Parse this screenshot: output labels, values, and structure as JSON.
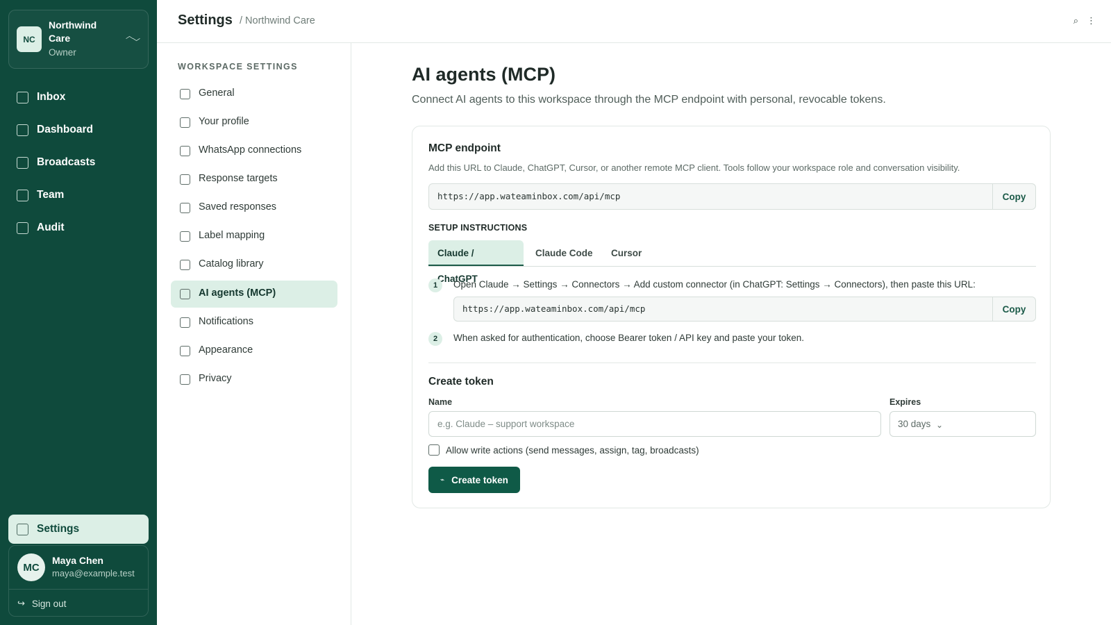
{
  "workspace": {
    "initials": "NC",
    "name": "Northwind Care",
    "role": "Owner"
  },
  "app_nav": [
    {
      "label": "Inbox"
    },
    {
      "label": "Dashboard"
    },
    {
      "label": "Broadcasts"
    },
    {
      "label": "Team"
    },
    {
      "label": "Audit"
    }
  ],
  "settings_link": {
    "label": "Settings"
  },
  "user": {
    "initials": "MC",
    "name": "Maya Chen",
    "email": "maya@example.test"
  },
  "sign_out": {
    "label": "Sign out",
    "icon": "sign-out-arrow-icon"
  },
  "header": {
    "title": "Settings",
    "breadcrumb": "/ Northwind Care",
    "icons": [
      "search-icon",
      "more-vertical-icon"
    ]
  },
  "settings_nav": {
    "heading": "WORKSPACE SETTINGS",
    "items": [
      {
        "label": "General"
      },
      {
        "label": "Your profile"
      },
      {
        "label": "WhatsApp connections"
      },
      {
        "label": "Response targets"
      },
      {
        "label": "Saved responses"
      },
      {
        "label": "Label mapping"
      },
      {
        "label": "Catalog library"
      },
      {
        "label": "AI agents (MCP)",
        "active": true
      },
      {
        "label": "Notifications"
      },
      {
        "label": "Appearance"
      },
      {
        "label": "Privacy"
      }
    ]
  },
  "main": {
    "title": "AI agents (MCP)",
    "subtitle": "Connect AI agents to this workspace through the MCP endpoint with personal, revocable tokens."
  },
  "endpoint": {
    "title": "MCP endpoint",
    "description": "Add this URL to Claude, ChatGPT, Cursor, or another remote MCP client. Tools follow your workspace role and conversation visibility.",
    "url": "https://app.wateaminbox.com/api/mcp",
    "copy_label": "Copy"
  },
  "setup": {
    "heading": "SETUP INSTRUCTIONS",
    "tabs": [
      {
        "label": "Claude / ChatGPT",
        "active": true
      },
      {
        "label": "Claude Code"
      },
      {
        "label": "Cursor"
      }
    ],
    "steps": [
      {
        "num": "1",
        "text": "Open Claude → Settings → Connectors → Add custom connector (in ChatGPT: Settings → Connectors), then paste this URL:"
      },
      {
        "num": "2",
        "text": "When asked for authentication, choose Bearer token / API key and paste your token."
      }
    ],
    "url": "https://app.wateaminbox.com/api/mcp",
    "copy_label": "Copy"
  },
  "create_token": {
    "title": "Create token",
    "name_label": "Name",
    "name_placeholder": "e.g. Claude – support workspace",
    "name_value": "",
    "expires_label": "Expires",
    "expires_value": "30 days",
    "write_label": "Allow write actions (send messages, assign, tag, broadcasts)",
    "write_checked": false,
    "button_label": "Create token",
    "button_icon": "key-icon"
  },
  "colors": {
    "sidebar": "#0f4a3c",
    "accent": "#0f5a47",
    "active_bg": "#dcefe6"
  }
}
